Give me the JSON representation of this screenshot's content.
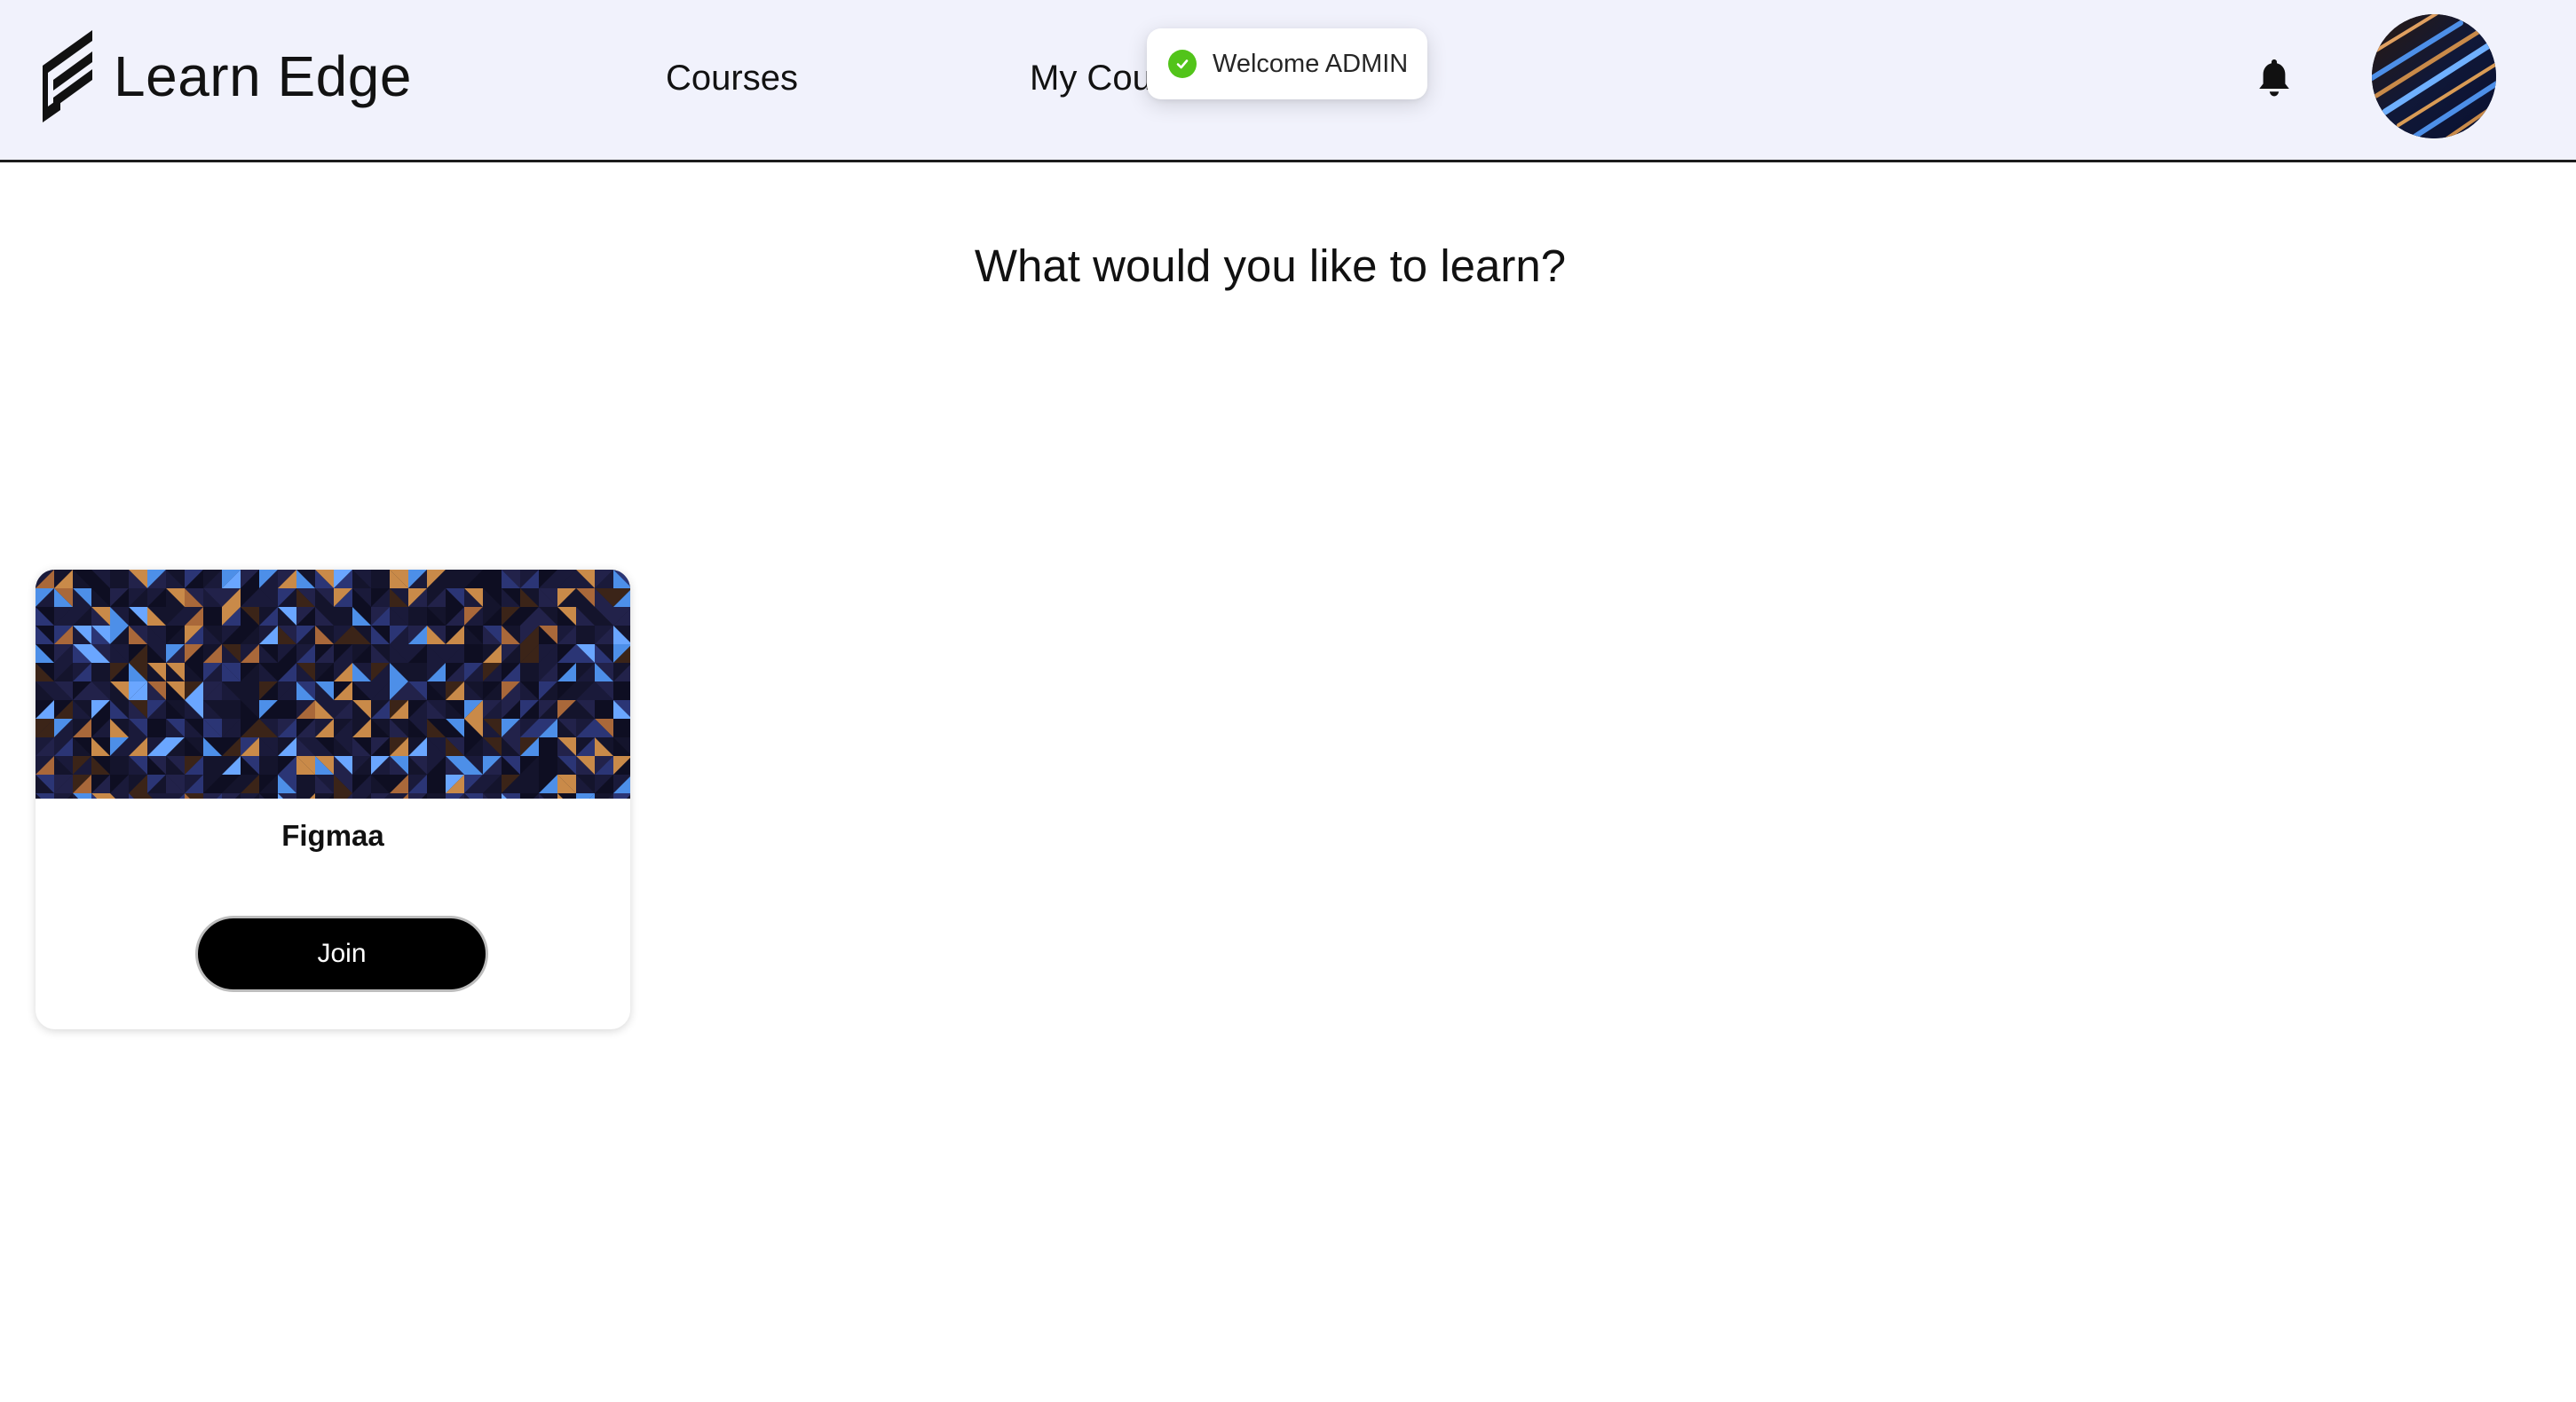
{
  "header": {
    "brand_name": "Learn Edge",
    "nav": {
      "courses_label": "Courses",
      "my_courses_label": "My Courses"
    },
    "notifications_icon": "bell-icon",
    "avatar_icon": "user-avatar"
  },
  "toast": {
    "message": "Welcome ADMIN",
    "icon": "check-circle-icon",
    "color": "#52c41a"
  },
  "main": {
    "heading": "What would you like to learn?",
    "courses": [
      {
        "title": "Figmaa",
        "join_label": "Join"
      }
    ]
  },
  "colors": {
    "header_bg": "#f1f2fc",
    "button_bg": "#000000",
    "cover_orange": "#c98a49",
    "cover_blue": "#4d8fe8",
    "cover_navy": "#1a1a3a"
  }
}
